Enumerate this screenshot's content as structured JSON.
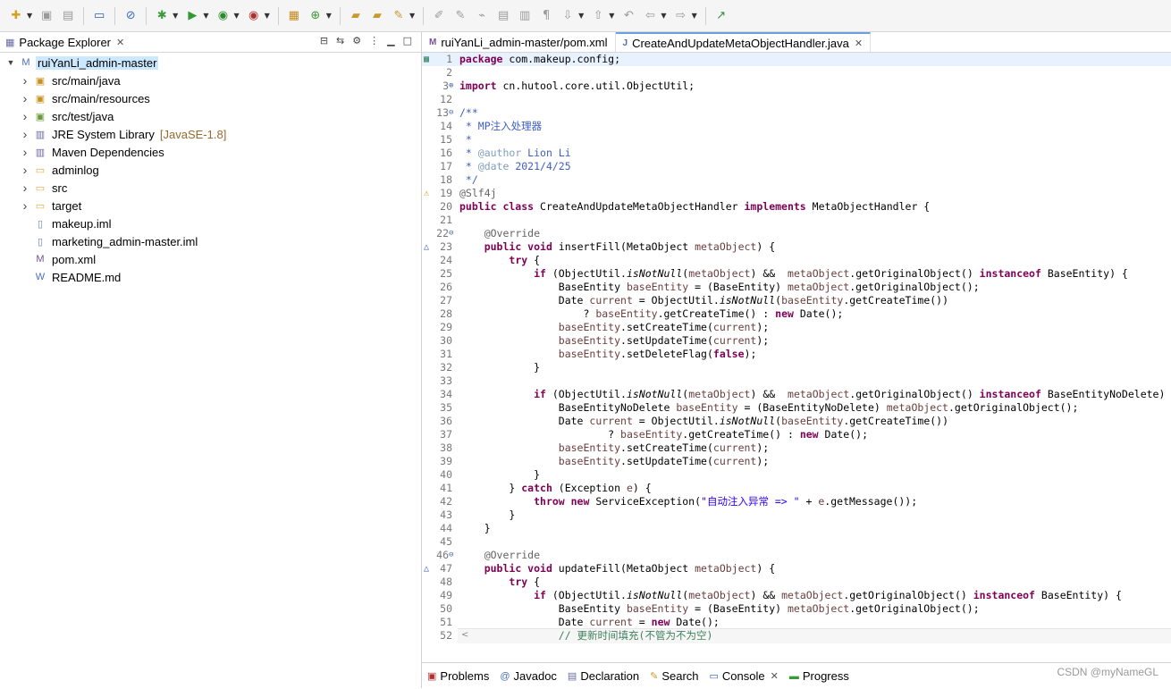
{
  "toolbar": {
    "buttons": [
      {
        "icon": "new-wizard-icon",
        "glyph": "✚",
        "color": "#d8a020",
        "dropdown": true
      },
      {
        "icon": "save-icon",
        "glyph": "▣",
        "color": "#9a9a9a",
        "dropdown": false
      },
      {
        "icon": "save-all-icon",
        "glyph": "▤",
        "color": "#9a9a9a",
        "dropdown": false
      },
      {
        "sep": true
      },
      {
        "icon": "open-console-icon",
        "glyph": "▭",
        "color": "#2a5fb0",
        "dropdown": false
      },
      {
        "sep": true
      },
      {
        "icon": "skip-breakpoints-icon",
        "glyph": "⊘",
        "color": "#3a6ec4",
        "dropdown": false
      },
      {
        "sep": true
      },
      {
        "icon": "debug-icon",
        "glyph": "✱",
        "color": "#3c9a3c",
        "dropdown": true
      },
      {
        "icon": "run-icon",
        "glyph": "▶",
        "color": "#2f9a2f",
        "dropdown": true
      },
      {
        "icon": "coverage-icon",
        "glyph": "◉",
        "color": "#2f8a2f",
        "dropdown": true
      },
      {
        "icon": "external-tools-icon",
        "glyph": "◉",
        "color": "#b03030",
        "dropdown": true
      },
      {
        "sep": true
      },
      {
        "icon": "new-java-package-icon",
        "glyph": "▦",
        "color": "#c48a20",
        "dropdown": false
      },
      {
        "icon": "new-java-class-icon",
        "glyph": "⊕",
        "color": "#3a9a3a",
        "dropdown": true
      },
      {
        "sep": true
      },
      {
        "icon": "open-type-icon",
        "glyph": "▰",
        "color": "#c69a30",
        "dropdown": false
      },
      {
        "icon": "open-task-icon",
        "glyph": "▰",
        "color": "#c69a30",
        "dropdown": false
      },
      {
        "icon": "search-icon",
        "glyph": "✎",
        "color": "#c69a30",
        "dropdown": true
      },
      {
        "sep": true
      },
      {
        "icon": "toggle-mark-occurrences-icon",
        "glyph": "✐",
        "color": "#9a9a9a",
        "dropdown": false
      },
      {
        "icon": "toggle-breadcrumb-icon",
        "glyph": "✎",
        "color": "#9a9a9a",
        "dropdown": false
      },
      {
        "icon": "block-selection-icon",
        "glyph": "⌁",
        "color": "#9a9a9a",
        "dropdown": false
      },
      {
        "icon": "word-wrap-icon",
        "glyph": "▤",
        "color": "#9a9a9a",
        "dropdown": false
      },
      {
        "icon": "show-whitespace-icon",
        "glyph": "▥",
        "color": "#9a9a9a",
        "dropdown": false
      },
      {
        "icon": "pilcrow-icon",
        "glyph": "¶",
        "color": "#9a9a9a",
        "dropdown": false
      },
      {
        "icon": "next-annotation-icon",
        "glyph": "⇩",
        "color": "#9a9a9a",
        "dropdown": true
      },
      {
        "icon": "prev-annotation-icon",
        "glyph": "⇧",
        "color": "#9a9a9a",
        "dropdown": true
      },
      {
        "icon": "last-edit-location-icon",
        "glyph": "↶",
        "color": "#9a9a9a",
        "dropdown": false
      },
      {
        "icon": "back-icon",
        "glyph": "⇦",
        "color": "#9a9a9a",
        "dropdown": true
      },
      {
        "icon": "forward-icon",
        "glyph": "⇨",
        "color": "#9a9a9a",
        "dropdown": true
      },
      {
        "sep": true
      },
      {
        "icon": "pin-editor-icon",
        "glyph": "↗",
        "color": "#3a8a3a",
        "dropdown": false
      }
    ]
  },
  "package_explorer": {
    "title": "Package Explorer",
    "tree": [
      {
        "label": "ruiYanLi_admin-master",
        "icon": "maven-project-icon",
        "glyph": "M",
        "color": "#4a6fb5",
        "expanded": true,
        "indent": 0,
        "selected": true
      },
      {
        "label": "src/main/java",
        "icon": "source-folder-icon",
        "glyph": "▣",
        "color": "#c8921f",
        "expanded": false,
        "indent": 1
      },
      {
        "label": "src/main/resources",
        "icon": "source-folder-icon",
        "glyph": "▣",
        "color": "#c8921f",
        "expanded": false,
        "indent": 1
      },
      {
        "label": "src/test/java",
        "icon": "source-folder-icon",
        "glyph": "▣",
        "color": "#6a9a3a",
        "expanded": false,
        "indent": 1
      },
      {
        "label": "JRE System Library",
        "deco": "[JavaSE-1.8]",
        "icon": "library-icon",
        "glyph": "▥",
        "color": "#6a6aa0",
        "expanded": false,
        "indent": 1
      },
      {
        "label": "Maven Dependencies",
        "icon": "library-icon",
        "glyph": "▥",
        "color": "#6a6aa0",
        "expanded": false,
        "indent": 1
      },
      {
        "label": "adminlog",
        "icon": "folder-icon",
        "glyph": "▭",
        "color": "#e0a83a",
        "expanded": false,
        "indent": 1
      },
      {
        "label": "src",
        "icon": "folder-icon",
        "glyph": "▭",
        "color": "#e0a83a",
        "expanded": false,
        "indent": 1
      },
      {
        "label": "target",
        "icon": "folder-icon",
        "glyph": "▭",
        "color": "#e0a83a",
        "expanded": false,
        "indent": 1
      },
      {
        "label": "makeup.iml",
        "icon": "file-icon",
        "glyph": "▯",
        "color": "#6a86b0",
        "leaf": true,
        "indent": 1
      },
      {
        "label": "marketing_admin-master.iml",
        "icon": "file-icon",
        "glyph": "▯",
        "color": "#6a86b0",
        "leaf": true,
        "indent": 1
      },
      {
        "label": "pom.xml",
        "icon": "maven-pom-icon",
        "glyph": "M",
        "color": "#7a4e99",
        "leaf": true,
        "indent": 1
      },
      {
        "label": "README.md",
        "icon": "markdown-file-icon",
        "glyph": "W",
        "color": "#4a6fb5",
        "leaf": true,
        "indent": 1
      }
    ]
  },
  "editor": {
    "tabs": [
      {
        "label": "ruiYanLi_admin-master/pom.xml",
        "active": false,
        "closable": false
      },
      {
        "label": "CreateAndUpdateMetaObjectHandler.java",
        "active": true,
        "closable": true
      }
    ],
    "lines": [
      {
        "n": "1",
        "hl": true,
        "marker": "bookmark",
        "html": "<span class=\"kw\">package</span> com.makeup.config;"
      },
      {
        "n": "2",
        "html": ""
      },
      {
        "n": "3",
        "fold": "⊕",
        "html": "<span class=\"kw\">import</span> cn.hutool.core.util.ObjectUtil;"
      },
      {
        "n": "12",
        "html": ""
      },
      {
        "n": "13",
        "fold": "⊖",
        "html": "<span class=\"cm\">/**</span>"
      },
      {
        "n": "14",
        "html": "<span class=\"cm\"> * MP注入处理器</span>"
      },
      {
        "n": "15",
        "html": "<span class=\"cm\"> *</span>"
      },
      {
        "n": "16",
        "html": "<span class=\"cm\"> * <b style=\"font-weight:normal;color:#7f9fbf\">@author</b> Lion Li</span>"
      },
      {
        "n": "17",
        "html": "<span class=\"cm\"> * <b style=\"font-weight:normal;color:#7f9fbf\">@date</b> 2021/4/25</span>"
      },
      {
        "n": "18",
        "html": "<span class=\"cm\"> */</span>"
      },
      {
        "n": "19",
        "marker": "warning",
        "html": "<span class=\"an\">@Slf4j</span>"
      },
      {
        "n": "20",
        "html": "<span class=\"kw\">public class</span> CreateAndUpdateMetaObjectHandler <span class=\"kw\">implements</span> MetaObjectHandler {"
      },
      {
        "n": "21",
        "html": ""
      },
      {
        "n": "22",
        "fold": "⊖",
        "html": "    <span class=\"an\">@Override</span>"
      },
      {
        "n": "23",
        "marker": "override",
        "html": "    <span class=\"kw\">public void</span> insertFill(MetaObject <span class=\"loc\">metaObject</span>) {"
      },
      {
        "n": "24",
        "html": "        <span class=\"kw\">try</span> {"
      },
      {
        "n": "25",
        "html": "            <span class=\"kw\">if</span> (ObjectUtil.<span class=\"it\">isNotNull</span>(<span class=\"loc\">metaObject</span>) &amp;&amp;  <span class=\"loc\">metaObject</span>.getOriginalObject() <span class=\"kw\">instanceof</span> BaseEntity) {"
      },
      {
        "n": "26",
        "html": "                BaseEntity <span class=\"loc\">baseEntity</span> = (BaseEntity) <span class=\"loc\">metaObject</span>.getOriginalObject();"
      },
      {
        "n": "27",
        "html": "                Date <span class=\"loc\">current</span> = ObjectUtil.<span class=\"it\">isNotNull</span>(<span class=\"loc\">baseEntity</span>.getCreateTime())"
      },
      {
        "n": "28",
        "html": "                    ? <span class=\"loc\">baseEntity</span>.getCreateTime() : <span class=\"kw\">new</span> Date();"
      },
      {
        "n": "29",
        "html": "                <span class=\"loc\">baseEntity</span>.setCreateTime(<span class=\"loc\">current</span>);"
      },
      {
        "n": "30",
        "html": "                <span class=\"loc\">baseEntity</span>.setUpdateTime(<span class=\"loc\">current</span>);"
      },
      {
        "n": "31",
        "html": "                <span class=\"loc\">baseEntity</span>.setDeleteFlag(<span class=\"kw\">false</span>);"
      },
      {
        "n": "32",
        "html": "            }"
      },
      {
        "n": "33",
        "html": ""
      },
      {
        "n": "34",
        "html": "            <span class=\"kw\">if</span> (ObjectUtil.<span class=\"it\">isNotNull</span>(<span class=\"loc\">metaObject</span>) &amp;&amp;  <span class=\"loc\">metaObject</span>.getOriginalObject() <span class=\"kw\">instanceof</span> BaseEntityNoDelete) {"
      },
      {
        "n": "35",
        "html": "                BaseEntityNoDelete <span class=\"loc\">baseEntity</span> = (BaseEntityNoDelete) <span class=\"loc\">metaObject</span>.getOriginalObject();"
      },
      {
        "n": "36",
        "html": "                Date <span class=\"loc\">current</span> = ObjectUtil.<span class=\"it\">isNotNull</span>(<span class=\"loc\">baseEntity</span>.getCreateTime())"
      },
      {
        "n": "37",
        "html": "                        ? <span class=\"loc\">baseEntity</span>.getCreateTime() : <span class=\"kw\">new</span> Date();"
      },
      {
        "n": "38",
        "html": "                <span class=\"loc\">baseEntity</span>.setCreateTime(<span class=\"loc\">current</span>);"
      },
      {
        "n": "39",
        "html": "                <span class=\"loc\">baseEntity</span>.setUpdateTime(<span class=\"loc\">current</span>);"
      },
      {
        "n": "40",
        "html": "            }"
      },
      {
        "n": "41",
        "html": "        } <span class=\"kw\">catch</span> (Exception <span class=\"loc\">e</span>) {"
      },
      {
        "n": "42",
        "html": "            <span class=\"kw\">throw new</span> ServiceException(<span class=\"str\">\"自动注入异常 => \"</span> + <span class=\"loc\">e</span>.getMessage());"
      },
      {
        "n": "43",
        "html": "        }"
      },
      {
        "n": "44",
        "html": "    }"
      },
      {
        "n": "45",
        "html": ""
      },
      {
        "n": "46",
        "fold": "⊖",
        "html": "    <span class=\"an\">@Override</span>"
      },
      {
        "n": "47",
        "marker": "override",
        "html": "    <span class=\"kw\">public void</span> updateFill(MetaObject <span class=\"loc\">metaObject</span>) {"
      },
      {
        "n": "48",
        "html": "        <span class=\"kw\">try</span> {"
      },
      {
        "n": "49",
        "html": "            <span class=\"kw\">if</span> (ObjectUtil.<span class=\"it\">isNotNull</span>(<span class=\"loc\">metaObject</span>) &amp;&amp; <span class=\"loc\">metaObject</span>.getOriginalObject() <span class=\"kw\">instanceof</span> BaseEntity) {"
      },
      {
        "n": "50",
        "html": "                BaseEntity <span class=\"loc\">baseEntity</span> = (BaseEntity) <span class=\"loc\">metaObject</span>.getOriginalObject();"
      },
      {
        "n": "51",
        "html": "                Date <span class=\"loc\">current</span> = <span class=\"kw\">new</span> Date();"
      },
      {
        "n": "52",
        "html": "                <span class=\"cm\" style=\"color:#3f7f5f\">// 更新时间填充(不管为不为空)</span>"
      }
    ]
  },
  "bottom_tabs": [
    {
      "label": "Problems",
      "icon": "problems-icon",
      "glyph": "▣",
      "color": "#b03030"
    },
    {
      "label": "Javadoc",
      "icon": "javadoc-icon",
      "glyph": "@",
      "color": "#4a6fb5"
    },
    {
      "label": "Declaration",
      "icon": "declaration-icon",
      "glyph": "▤",
      "color": "#6a6aa0"
    },
    {
      "label": "Search",
      "icon": "search-icon",
      "glyph": "✎",
      "color": "#c69a30"
    },
    {
      "label": "Console",
      "icon": "console-icon",
      "glyph": "▭",
      "color": "#2a5fb0",
      "active": true
    },
    {
      "label": "Progress",
      "icon": "progress-icon",
      "glyph": "▬",
      "color": "#3a9a3a"
    }
  ],
  "watermark": "CSDN @myNameGL"
}
